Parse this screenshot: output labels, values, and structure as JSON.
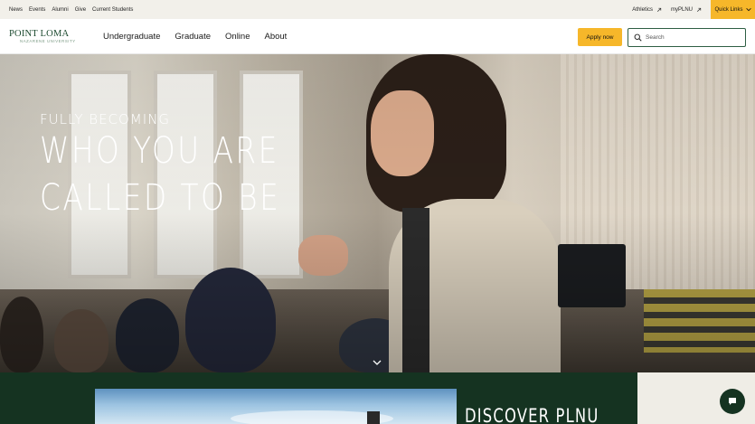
{
  "utility_nav": {
    "left_links": [
      "News",
      "Events",
      "Alumni",
      "Give",
      "Current Students"
    ],
    "athletics_label": "Athletics",
    "myplnu_label": "myPLNU",
    "quick_links_label": "Quick Links"
  },
  "main_nav": {
    "logo_top": "POINT LOMA",
    "logo_bottom": "NAZARENE UNIVERSITY",
    "links": [
      "Undergraduate",
      "Graduate",
      "Online",
      "About"
    ],
    "apply_label": "Apply now",
    "search_placeholder": "Search"
  },
  "hero": {
    "kicker": "FULLY BECOMING",
    "headline_line1": "WHO YOU ARE",
    "headline_line2": "CALLED TO BE"
  },
  "discover": {
    "title": "DISCOVER PLNU"
  },
  "colors": {
    "brand_green": "#153321",
    "accent_gold": "#f6b72a",
    "utility_bg": "#f2f0ea"
  },
  "icons": {
    "external": "external-link-icon",
    "chevron": "chevron-down-icon",
    "search": "search-icon",
    "chat": "chat-icon"
  }
}
